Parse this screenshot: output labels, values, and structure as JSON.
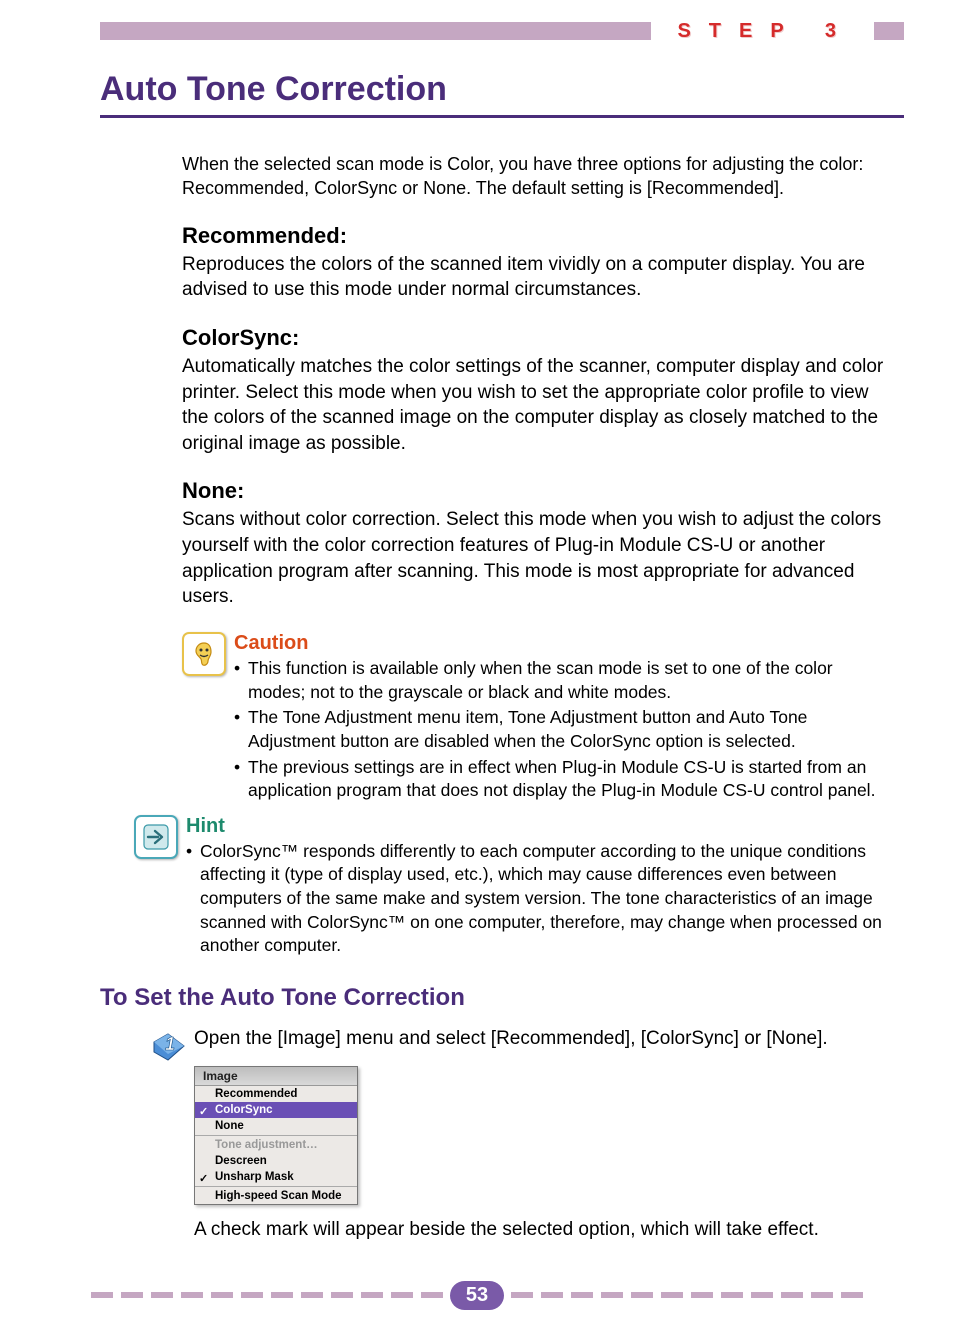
{
  "step": {
    "label": "STEP 3"
  },
  "title": "Auto Tone Correction",
  "intro": "When the selected scan mode is Color, you have three options for adjusting the color: Recommended, ColorSync or None. The default setting is [Recommended].",
  "options": {
    "recommended": {
      "heading": "Recommended:",
      "body": "Reproduces the colors of the scanned item vividly on a computer display. You are advised to use this mode under normal circumstances."
    },
    "colorsync": {
      "heading": "ColorSync:",
      "body": "Automatically matches the color settings of the scanner, computer display and color printer. Select this mode when you wish to set the appropriate color profile to view the colors of the scanned image on the computer display as closely matched to the original image as possible."
    },
    "none": {
      "heading": "None:",
      "body": "Scans without color correction. Select this mode when you wish to adjust the colors yourself with the color correction features of Plug-in Module CS-U or another application program after scanning. This mode is most appropriate for advanced users."
    }
  },
  "caution": {
    "title": "Caution",
    "bullets": [
      "This function is available only when the scan mode is set to one of the color modes; not to the grayscale or black and white modes.",
      "The Tone Adjustment menu item, Tone Adjustment button and Auto Tone Adjustment button are disabled when the ColorSync option is selected.",
      "The previous settings are in effect when Plug-in Module CS-U is started from an application program that does not display the Plug-in Module CS-U control panel."
    ]
  },
  "hint": {
    "title": "Hint",
    "bullets": [
      "ColorSync™ responds differently to each computer according to the unique conditions affecting it (type of display used, etc.), which may cause differences even between computers of the same make and system version. The tone characteristics of an image scanned with ColorSync™ on one computer, therefore, may change when processed on another computer."
    ]
  },
  "subhead": "To Set the Auto Tone Correction",
  "step1": {
    "text": "Open the [Image] menu and select [Recommended], [ColorSync] or [None].",
    "followup": "A check mark will appear beside the selected option, which will take effect."
  },
  "menu": {
    "title": "Image",
    "items": [
      {
        "label": "Recommended",
        "checked": false,
        "selected": false,
        "dim": false
      },
      {
        "label": "ColorSync",
        "checked": true,
        "selected": true,
        "dim": false
      },
      {
        "label": "None",
        "checked": false,
        "selected": false,
        "dim": false
      }
    ],
    "items2": [
      {
        "label": "Tone adjustment…",
        "checked": false,
        "selected": false,
        "dim": true
      },
      {
        "label": "Descreen",
        "checked": false,
        "selected": false,
        "dim": false
      },
      {
        "label": "Unsharp Mask",
        "checked": true,
        "selected": false,
        "dim": false
      }
    ],
    "items3": [
      {
        "label": "High-speed Scan Mode",
        "checked": false,
        "selected": false,
        "dim": false
      }
    ]
  },
  "page_number": "53"
}
